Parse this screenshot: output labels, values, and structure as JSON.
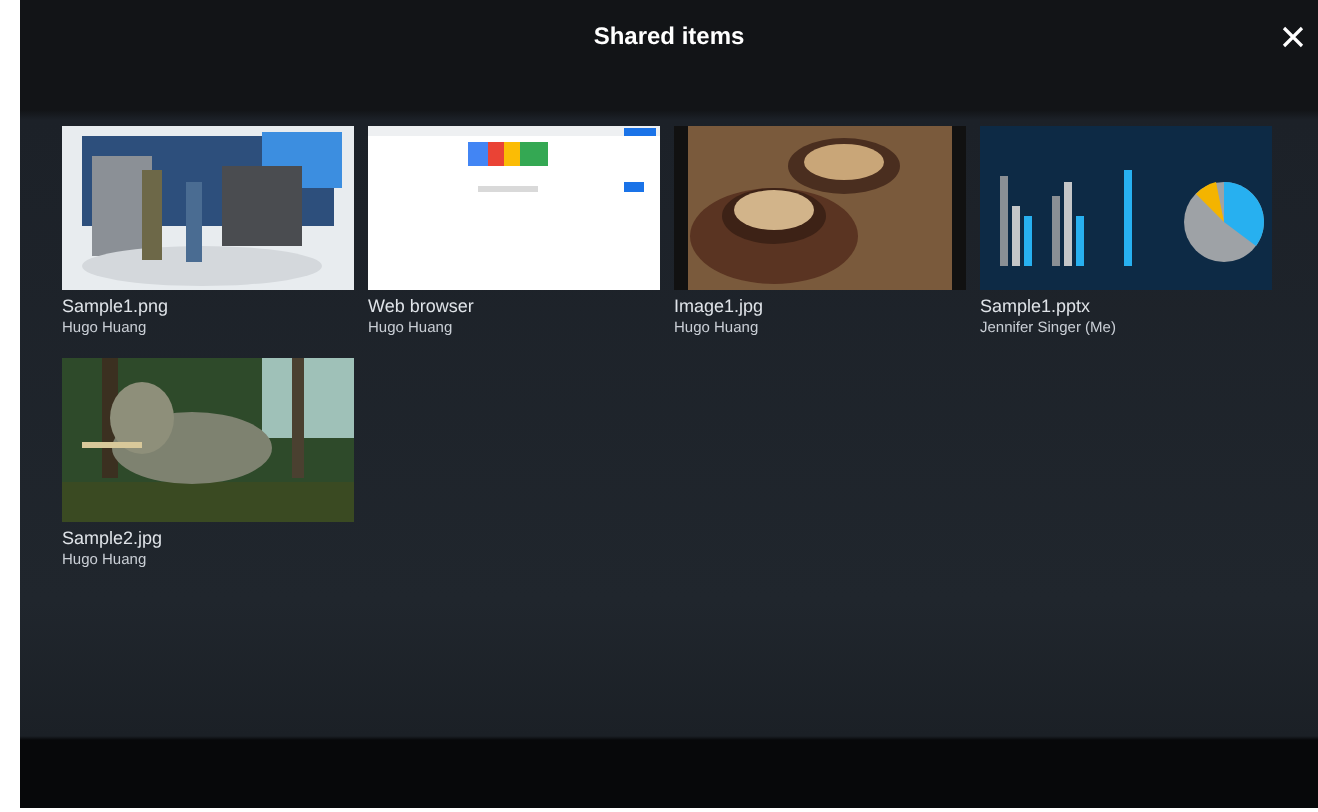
{
  "dialog": {
    "title": "Shared items"
  },
  "items": [
    {
      "kind": "picture",
      "name": "Sample1.png",
      "owner": "Hugo Huang"
    },
    {
      "kind": "picture",
      "name": "Web browser",
      "owner": "Hugo Huang"
    },
    {
      "kind": "picture",
      "name": "Image1.jpg",
      "owner": "Hugo Huang"
    },
    {
      "kind": "picture",
      "name": "Sample1.pptx",
      "owner": "Jennifer Singer (Me)"
    },
    {
      "kind": "picture",
      "name": "Sample2.jpg",
      "owner": "Hugo Huang"
    }
  ]
}
